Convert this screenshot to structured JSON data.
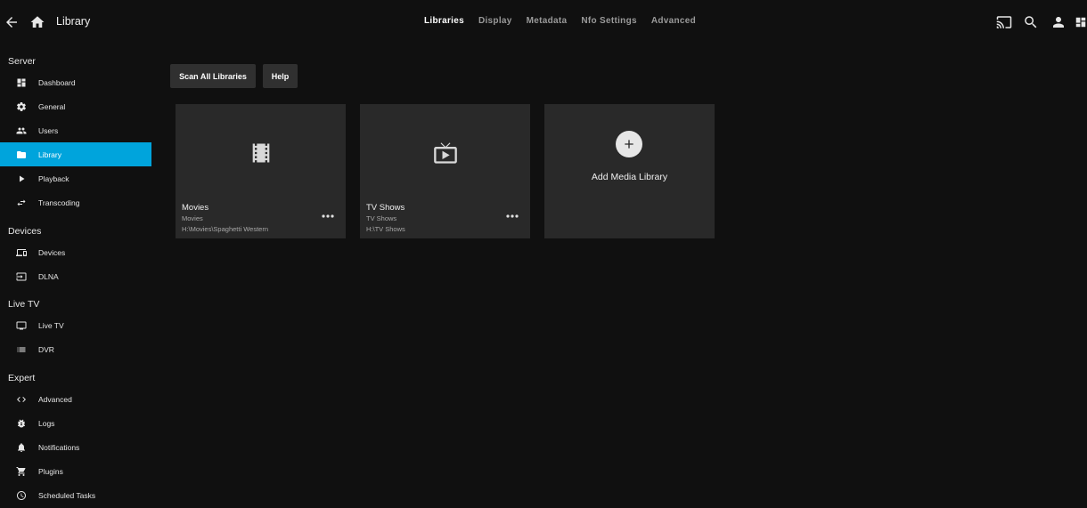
{
  "header": {
    "title": "Library",
    "tabs": [
      {
        "label": "Libraries",
        "active": true
      },
      {
        "label": "Display",
        "active": false
      },
      {
        "label": "Metadata",
        "active": false
      },
      {
        "label": "Nfo Settings",
        "active": false
      },
      {
        "label": "Advanced",
        "active": false
      }
    ],
    "icons": [
      "back-arrow-icon",
      "home-icon",
      "cast-icon",
      "search-icon",
      "user-icon",
      "dashboard-icon"
    ]
  },
  "sidebar": {
    "sections": [
      {
        "title": "Server",
        "items": [
          {
            "label": "Dashboard",
            "icon": "dashboard-icon"
          },
          {
            "label": "General",
            "icon": "gear-icon"
          },
          {
            "label": "Users",
            "icon": "people-icon"
          },
          {
            "label": "Library",
            "icon": "folder-icon",
            "active": true
          },
          {
            "label": "Playback",
            "icon": "play-icon"
          },
          {
            "label": "Transcoding",
            "icon": "swap-icon"
          }
        ]
      },
      {
        "title": "Devices",
        "items": [
          {
            "label": "Devices",
            "icon": "devices-icon"
          },
          {
            "label": "DLNA",
            "icon": "input-icon"
          }
        ]
      },
      {
        "title": "Live TV",
        "items": [
          {
            "label": "Live TV",
            "icon": "tv-icon"
          },
          {
            "label": "DVR",
            "icon": "list-icon"
          }
        ]
      },
      {
        "title": "Expert",
        "items": [
          {
            "label": "Advanced",
            "icon": "code-icon"
          },
          {
            "label": "Logs",
            "icon": "bug-icon"
          },
          {
            "label": "Notifications",
            "icon": "bell-icon"
          },
          {
            "label": "Plugins",
            "icon": "cart-icon"
          },
          {
            "label": "Scheduled Tasks",
            "icon": "clock-icon"
          }
        ]
      }
    ]
  },
  "toolbar": {
    "scan_label": "Scan All Libraries",
    "help_label": "Help"
  },
  "libraries": [
    {
      "name": "Movies",
      "type": "Movies",
      "path": "H:\\Movies\\Spaghetti Western",
      "icon": "film-icon"
    },
    {
      "name": "TV Shows",
      "type": "TV Shows",
      "path": "H:\\TV Shows",
      "icon": "live-tv-icon"
    }
  ],
  "add_library": {
    "label": "Add Media Library",
    "icon": "add-circle-icon"
  }
}
